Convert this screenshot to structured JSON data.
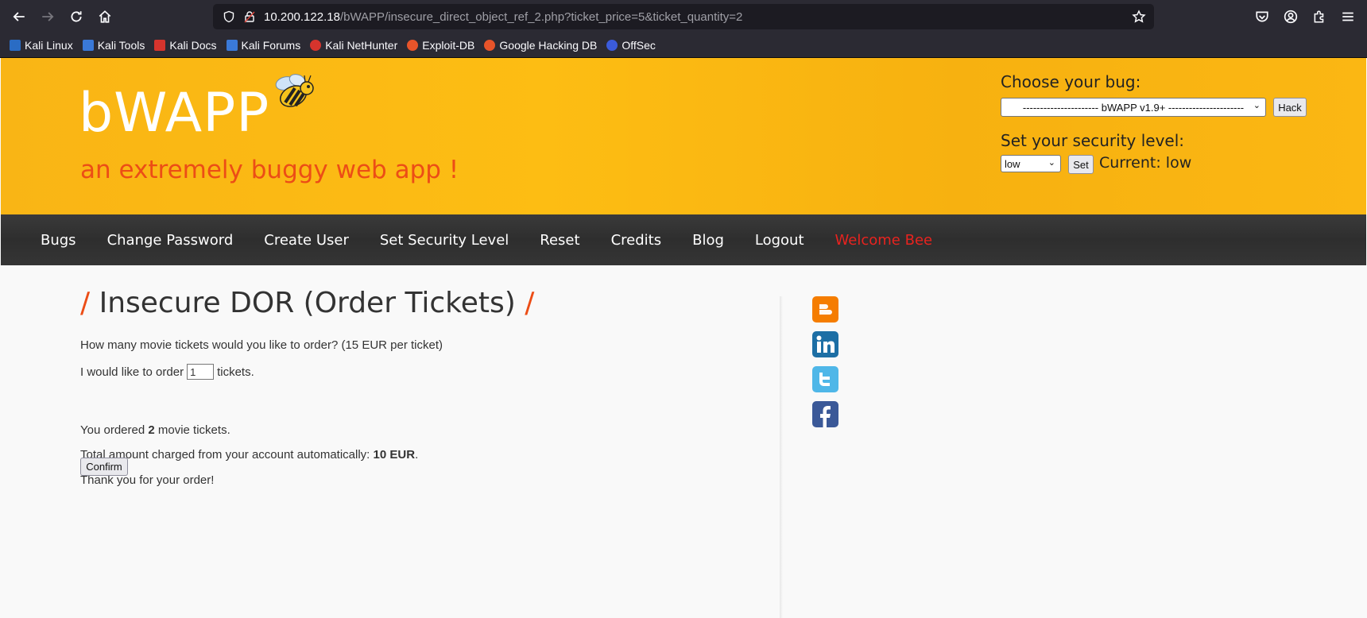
{
  "browser": {
    "url_host": "10.200.122.18",
    "url_path": "/bWAPP/insecure_direct_object_ref_2.php?ticket_price=5&ticket_quantity=2",
    "bookmarks": [
      {
        "label": "Kali Linux",
        "color": "#2a6cc4"
      },
      {
        "label": "Kali Tools",
        "color": "#3a79d8"
      },
      {
        "label": "Kali Docs",
        "color": "#d6342d"
      },
      {
        "label": "Kali Forums",
        "color": "#3a79d8"
      },
      {
        "label": "Kali NetHunter",
        "color": "#d6342d"
      },
      {
        "label": "Exploit-DB",
        "color": "#e8542a"
      },
      {
        "label": "Google Hacking DB",
        "color": "#e8542a"
      },
      {
        "label": "OffSec",
        "color": "#3b5bdb"
      }
    ]
  },
  "header": {
    "logo": "bWAPP",
    "tagline": "an extremely buggy web app !",
    "choose_label": "Choose your bug:",
    "bug_selected": "---------------------- bWAPP v1.9+ ----------------------",
    "hack_label": "Hack",
    "security_label": "Set your security level:",
    "level_selected": "low",
    "set_label": "Set",
    "current_text": "Current: low"
  },
  "menu": [
    "Bugs",
    "Change Password",
    "Create User",
    "Set Security Level",
    "Reset",
    "Credits",
    "Blog",
    "Logout",
    "Welcome Bee"
  ],
  "main": {
    "title": "Insecure DOR (Order Tickets)",
    "slash": "/",
    "question": "How many movie tickets would you like to order? (15 EUR per ticket)",
    "order_prefix": "I would like to order",
    "quantity_value": "1",
    "order_suffix": "tickets.",
    "confirm_label": "Confirm",
    "ordered_prefix": "You ordered",
    "ordered_count": "2",
    "ordered_suffix": "movie tickets.",
    "total_prefix": "Total amount charged from your account automatically:",
    "total_amount": "10 EUR",
    "total_suffix": ".",
    "thanks": "Thank you for your order!"
  },
  "social": [
    "blogger-icon",
    "linkedin-icon",
    "twitter-icon",
    "facebook-icon"
  ]
}
